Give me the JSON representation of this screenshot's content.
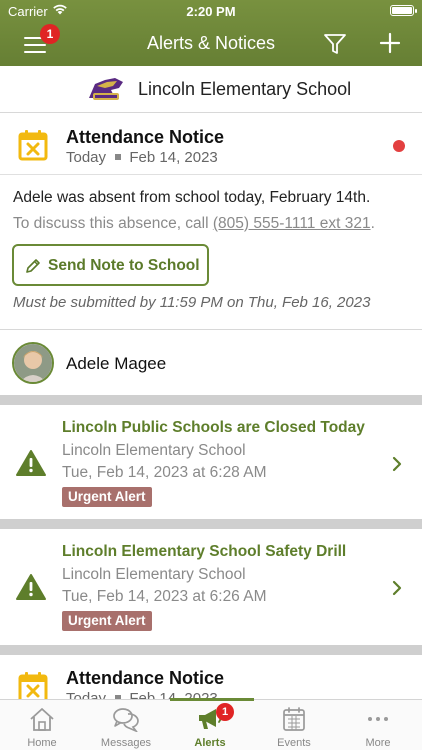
{
  "status_bar": {
    "carrier": "Carrier",
    "time": "2:20 PM"
  },
  "nav": {
    "title": "Alerts & Notices",
    "menu_badge": "1"
  },
  "school": {
    "name": "Lincoln Elementary School"
  },
  "attendance_notice": {
    "title": "Attendance Notice",
    "date_prefix": "Today",
    "date": "Feb 14, 2023",
    "message": "Adele was absent from school today, February 14th.",
    "discuss_prefix": "To discuss this absence, call ",
    "phone": "(805) 555-1111 ext 321",
    "discuss_suffix": ".",
    "button_label": "Send Note to School",
    "deadline": "Must be submitted by 11:59 PM on Thu, Feb 16, 2023",
    "student_name": "Adele Magee"
  },
  "alerts": [
    {
      "title": "Lincoln Public Schools are Closed Today",
      "school": "Lincoln Elementary School",
      "time": "Tue, Feb 14, 2023 at 6:28 AM",
      "badge": "Urgent Alert"
    },
    {
      "title": "Lincoln Elementary School Safety Drill",
      "school": "Lincoln Elementary School",
      "time": "Tue, Feb 14, 2023 at 6:26 AM",
      "badge": "Urgent Alert"
    }
  ],
  "attendance_notice_2": {
    "title": "Attendance Notice",
    "date_prefix": "Today",
    "date": "Feb 14, 2023"
  },
  "tabs": [
    {
      "label": "Home",
      "icon": "home-icon"
    },
    {
      "label": "Messages",
      "icon": "messages-icon"
    },
    {
      "label": "Alerts",
      "icon": "megaphone-icon",
      "badge": "1",
      "active": true
    },
    {
      "label": "Events",
      "icon": "calendar-icon"
    },
    {
      "label": "More",
      "icon": "more-icon"
    }
  ],
  "colors": {
    "brand_green": "#6a8a36",
    "alert_title": "#5e7e2b",
    "urgent_badge": "#a8706c",
    "unread_dot": "#e34040",
    "warning_icon": "#5e7e2b",
    "calendar_icon": "#f2b90f"
  }
}
